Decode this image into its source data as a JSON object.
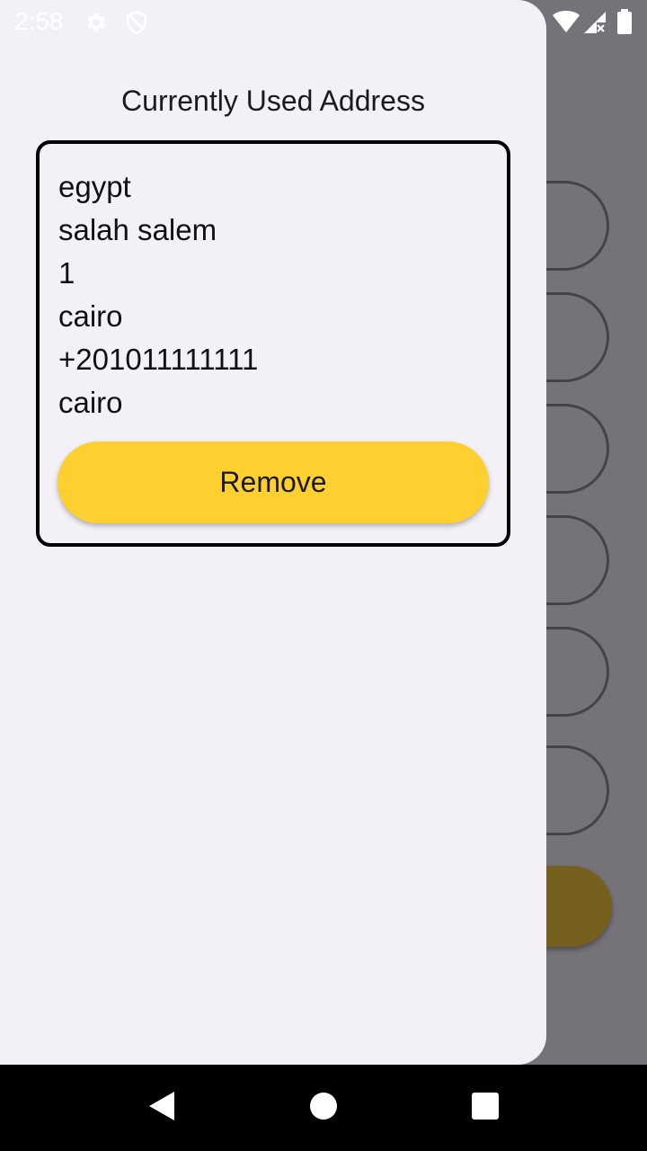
{
  "status_bar": {
    "time": "2:58",
    "icons": [
      "settings-gear-icon",
      "shield-icon",
      "wifi-icon",
      "signal-icon",
      "battery-icon"
    ]
  },
  "drawer": {
    "title": "Currently Used Address",
    "address": {
      "lines": [
        "egypt",
        "salah salem",
        "1",
        "cairo",
        "+201011111111",
        "cairo"
      ],
      "remove_label": "Remove"
    }
  },
  "colors": {
    "drawer_bg": "#f4f0f7",
    "accent_button": "#fdd030",
    "scrim": "#76727a"
  },
  "nav_bar": {
    "icons": [
      "back-icon",
      "home-icon",
      "recents-icon"
    ]
  }
}
